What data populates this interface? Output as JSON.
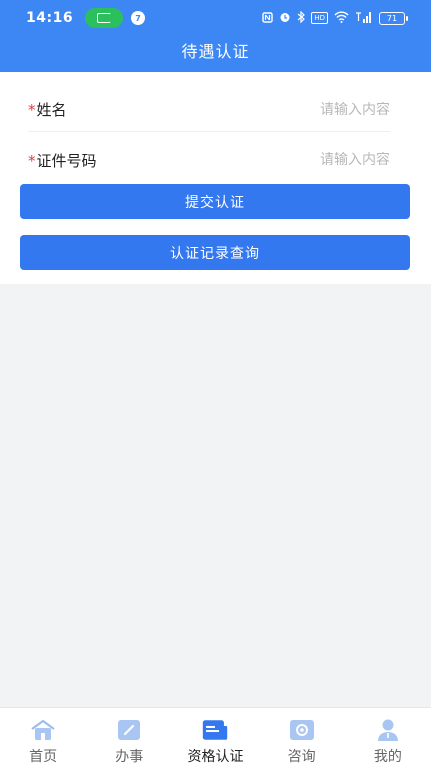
{
  "status_bar": {
    "time": "14:16",
    "notification_count": "7",
    "battery": "71"
  },
  "header": {
    "title": "待遇认证"
  },
  "form": {
    "fields": [
      {
        "label": "姓名",
        "placeholder": "请输入内容",
        "value": ""
      },
      {
        "label": "证件号码",
        "placeholder": "请输入内容",
        "value": ""
      }
    ],
    "required_mark": "*",
    "submit_label": "提交认证",
    "records_label": "认证记录查询"
  },
  "tabbar": {
    "items": [
      {
        "label": "首页",
        "icon": "home-icon"
      },
      {
        "label": "办事",
        "icon": "edit-icon"
      },
      {
        "label": "资格认证",
        "icon": "certificate-icon",
        "active": true
      },
      {
        "label": "咨询",
        "icon": "consult-icon"
      },
      {
        "label": "我的",
        "icon": "user-icon"
      }
    ]
  },
  "colors": {
    "primary": "#3d87f5",
    "button": "#3478f0",
    "required": "#e23b3b",
    "icon_inactive": "#a9c6f2",
    "icon_active": "#3478f0"
  }
}
